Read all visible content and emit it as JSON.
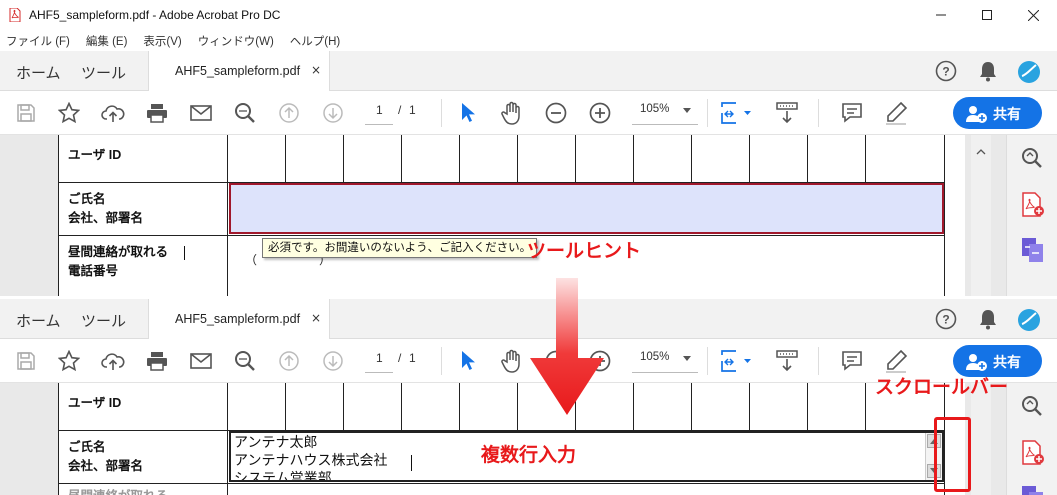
{
  "window": {
    "title": "AHF5_sampleform.pdf - Adobe Acrobat Pro DC"
  },
  "menubar": [
    "ファイル (F)",
    "編集 (E)",
    "表示(V)",
    "ウィンドウ(W)",
    "ヘルプ(H)"
  ],
  "tabs": {
    "home": "ホーム",
    "tools": "ツール",
    "document": "AHF5_sampleform.pdf",
    "close": "×"
  },
  "toolbar": {
    "page_current": "1",
    "page_sep": "/",
    "page_total": "1",
    "zoom": "105%",
    "share_label": "共有"
  },
  "form": {
    "user_id_label": "ユーザ ID",
    "name_label_1": "ご氏名",
    "name_label_2": "会社、部署名",
    "phone_label_1": "昼間連絡が取れる",
    "phone_label_2": "電話番号",
    "phone_paren_open": "（",
    "phone_paren_close": "）",
    "multiline_values": [
      "アンテナ太郎",
      "アンテナハウス株式会社",
      "システム営業部"
    ]
  },
  "tooltip": "必須です。お間違いのないよう、ご記入ください。",
  "annotations": {
    "tooltip_label": "ツールヒント",
    "scrollbar_label": "スクロールバー",
    "multiline_label": "複数行入力"
  },
  "colors": {
    "accent": "#1473e6",
    "annotation": "#e8191b",
    "field_highlight": "#dde3fb",
    "field_border": "#a0182c",
    "tooltip_bg": "#ffffe1"
  }
}
